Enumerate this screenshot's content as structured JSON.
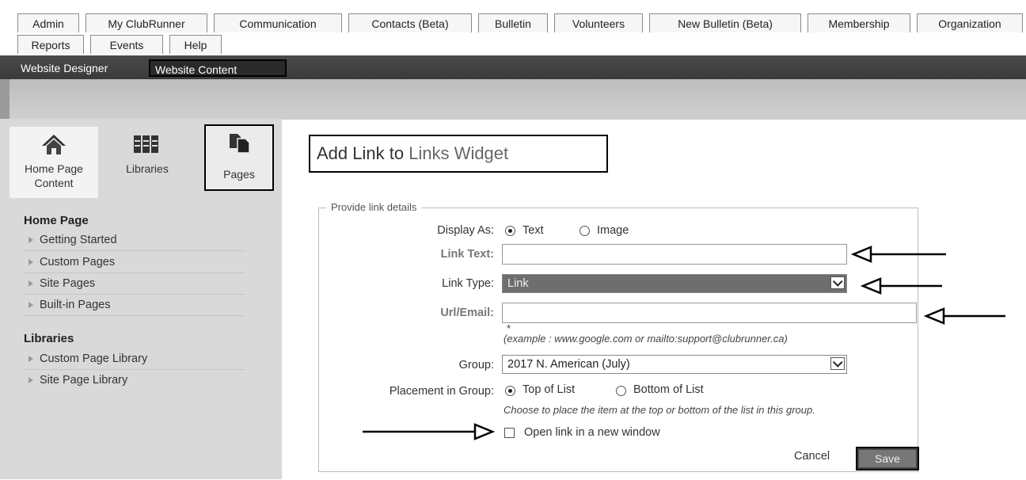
{
  "top_tabs": [
    {
      "label": "Admin"
    },
    {
      "label": "My ClubRunner"
    },
    {
      "label": "Communication"
    },
    {
      "label": "Contacts (Beta)"
    },
    {
      "label": "Bulletin"
    },
    {
      "label": "Volunteers"
    },
    {
      "label": "New Bulletin (Beta)"
    },
    {
      "label": "Membership"
    },
    {
      "label": "Organization"
    },
    {
      "label": "Reports"
    },
    {
      "label": "Events"
    },
    {
      "label": "Help"
    }
  ],
  "sub_tabs": [
    {
      "label": "Website Designer"
    },
    {
      "label": "Website Content"
    }
  ],
  "icon_buttons": [
    {
      "label": "Home Page Content",
      "icon": "home-icon"
    },
    {
      "label": "Libraries",
      "icon": "libraries-icon"
    },
    {
      "label": "Pages",
      "icon": "pages-icon"
    }
  ],
  "sidebar": {
    "home_section": "Home Page",
    "home_items": [
      "Getting Started",
      "Custom Pages",
      "Site Pages",
      "Built-in Pages"
    ],
    "libraries_section": "Libraries",
    "library_items": [
      "Custom Page Library",
      "Site Page Library"
    ]
  },
  "page_title": {
    "prefix": "Add Link to",
    "widget": "Links Widget"
  },
  "form": {
    "legend": "Provide link details",
    "display_as_label": "Display As:",
    "display_text": "Text",
    "display_image": "Image",
    "link_text_label": "Link Text:",
    "link_text_value": "",
    "link_type_label": "Link Type:",
    "link_type_value": "Link",
    "url_label": "Url/Email:",
    "url_value": "",
    "required_mark": "*",
    "url_example": "(example : www.google.com or mailto:support@clubrunner.ca)",
    "group_label": "Group:",
    "group_value": "2017 N. American (July)",
    "placement_label": "Placement in Group:",
    "placement_top": "Top of List",
    "placement_bottom": "Bottom of List",
    "placement_hint": "Choose to place the item at the top or bottom of the list in this group.",
    "new_window_label": "Open link in a new window",
    "cancel_label": "Cancel",
    "save_label": "Save"
  },
  "colors": {
    "subnav_bg": "#3a3a3a",
    "sidebar_bg": "#d9d9d9",
    "annotation": "#000000"
  }
}
